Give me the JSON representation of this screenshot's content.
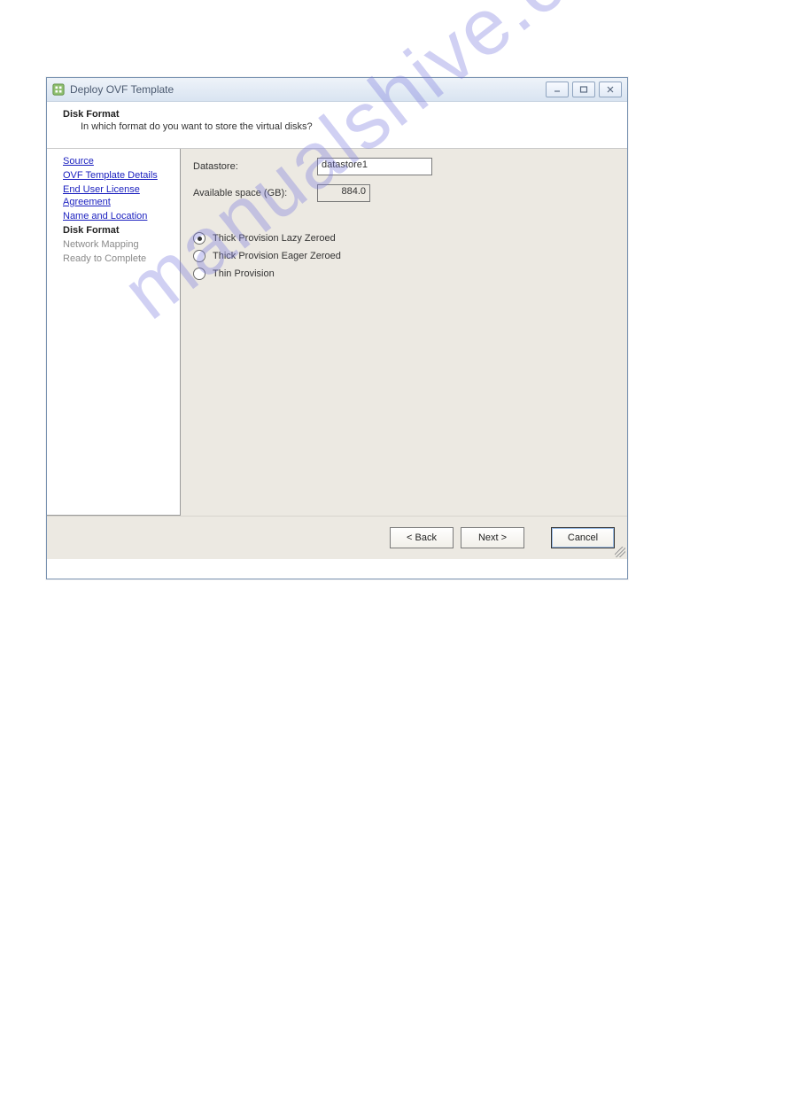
{
  "window": {
    "title": "Deploy OVF Template"
  },
  "header": {
    "title": "Disk Format",
    "subtitle": "In which format do you want to store the virtual disks?"
  },
  "sidebar": {
    "items": [
      {
        "label": "Source",
        "state": "link"
      },
      {
        "label": "OVF Template Details",
        "state": "link"
      },
      {
        "label": "End User License Agreement",
        "state": "link"
      },
      {
        "label": "Name and Location",
        "state": "link"
      },
      {
        "label": "Disk Format",
        "state": "current"
      },
      {
        "label": "Network Mapping",
        "state": "disabled"
      },
      {
        "label": "Ready to Complete",
        "state": "disabled"
      }
    ]
  },
  "fields": {
    "datastore_label": "Datastore:",
    "datastore_value": "datastore1",
    "space_label": "Available space (GB):",
    "space_value": "884.0"
  },
  "radios": {
    "options": [
      {
        "label": "Thick Provision Lazy Zeroed",
        "selected": true
      },
      {
        "label": "Thick Provision Eager Zeroed",
        "selected": false
      },
      {
        "label": "Thin Provision",
        "selected": false
      }
    ]
  },
  "buttons": {
    "back": "< Back",
    "next": "Next >",
    "cancel": "Cancel"
  },
  "watermark": "manualshive.com"
}
